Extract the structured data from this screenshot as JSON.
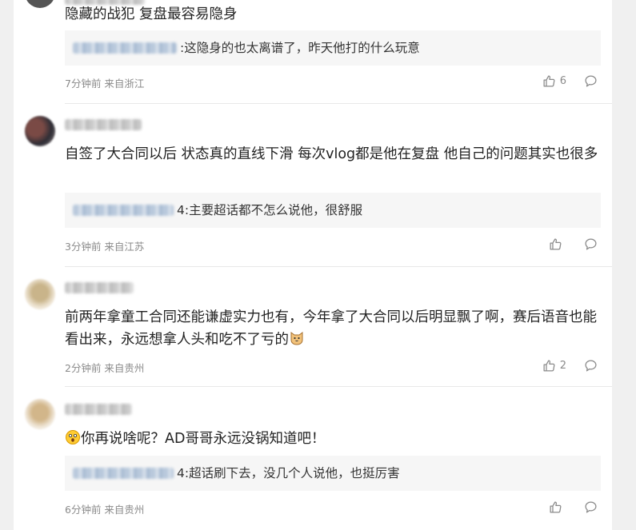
{
  "comments": [
    {
      "text": "隐藏的战犯 复盘最容易隐身",
      "reply_text": ":这隐身的也太离谱了，昨天他打的什么玩意",
      "meta": "7分钟前 来自浙江",
      "likes": "6"
    },
    {
      "text": "自签了大合同以后 状态真的直线下滑 每次vlog都是他在复盘 他自己的问题其实也很多",
      "reply_text": "4:主要超话都不怎么说他，很舒服",
      "meta": "3分钟前 来自江苏",
      "likes": ""
    },
    {
      "text": "前两年拿童工合同还能谦虚实力也有，今年拿了大合同以后明显飘了啊，赛后语音也能看出来，永远想拿人头和吃不了亏的",
      "emoji": "cat-face",
      "reply_text": "",
      "meta": "2分钟前 来自贵州",
      "likes": "2"
    },
    {
      "text": "你再说啥呢？AD哥哥永远没锅知道吧！",
      "emoji": "astonished-face",
      "reply_text": "4:超话刷下去，没几个人说他，也挺厉害",
      "meta": "6分钟前 来自贵州",
      "likes": ""
    }
  ]
}
